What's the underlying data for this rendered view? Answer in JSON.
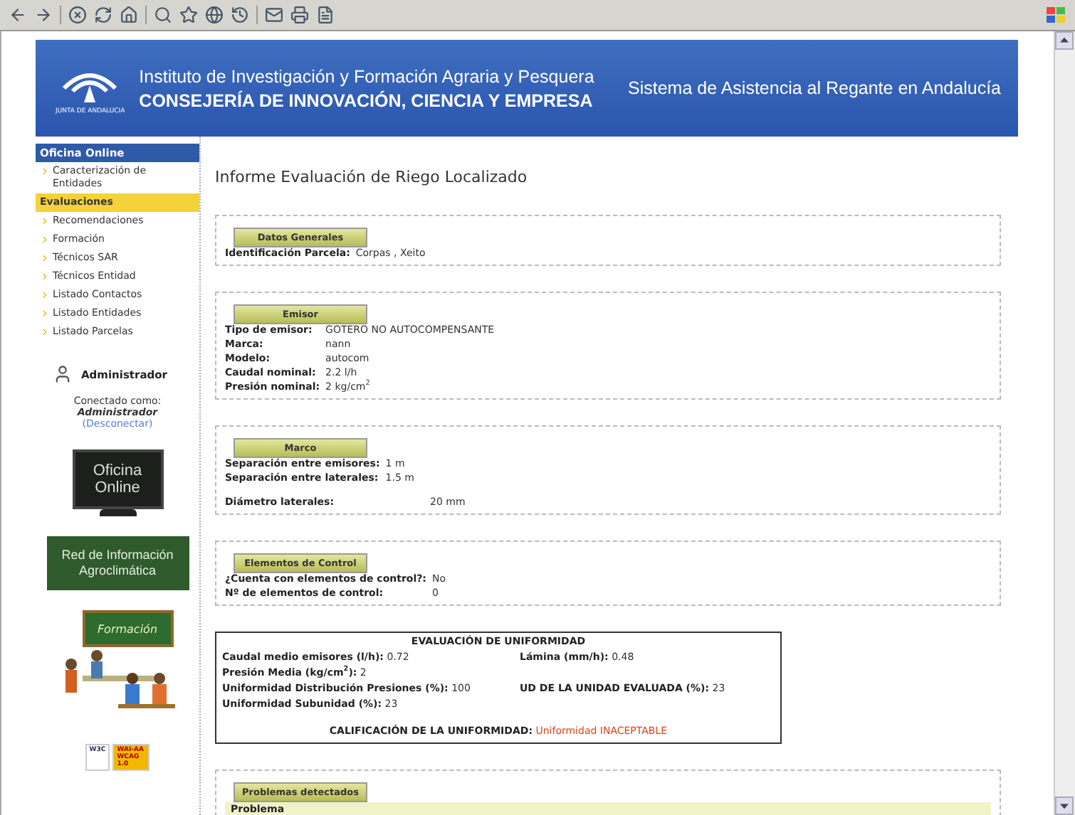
{
  "header": {
    "logo_caption": "JUNTA DE ANDALUCIA",
    "institute": "Instituto de Investigación y Formación Agraria y Pesquera",
    "ministry": "CONSEJERÍA DE INNOVACIÓN, CIENCIA Y EMPRESA",
    "system_title": "Sistema de Asistencia al Regante en Andalucía"
  },
  "sidebar": {
    "heading": "Oficina Online",
    "items": [
      {
        "label": "Caracterización de Entidades",
        "selected": false
      },
      {
        "label": "Evaluaciones",
        "selected": true
      },
      {
        "label": "Recomendaciones",
        "selected": false
      },
      {
        "label": "Formación",
        "selected": false
      },
      {
        "label": "Técnicos SAR",
        "selected": false
      },
      {
        "label": "Técnicos Entidad",
        "selected": false
      },
      {
        "label": "Listado Contactos",
        "selected": false
      },
      {
        "label": "Listado Entidades",
        "selected": false
      },
      {
        "label": "Listado Parcelas",
        "selected": false
      }
    ],
    "user": {
      "role": "Administrador",
      "connected_as": "Conectado como:",
      "name": "Administrador",
      "logout": "(Desconectar)"
    },
    "banners": [
      {
        "kind": "monitor",
        "text": "Oficina Online"
      },
      {
        "kind": "board",
        "text": "Red de Información Agroclimática"
      },
      {
        "kind": "classroom",
        "text": "Formación"
      }
    ],
    "badges": [
      {
        "text": "W3C"
      },
      {
        "text": "WAI-AA WCAG 1.0"
      }
    ]
  },
  "main": {
    "title": "Informe Evaluación de Riego Localizado",
    "sections": [
      {
        "legend": "Datos Generales",
        "fields": [
          {
            "label": "Identificación Parcela:",
            "value": "Corpas , Xeito"
          }
        ]
      },
      {
        "legend": "Emisor",
        "fields": [
          {
            "label": "Tipo de emisor:",
            "value": "GOTERO NO AUTOCOMPENSANTE"
          },
          {
            "label": "Marca:",
            "value": "nann"
          },
          {
            "label": "Modelo:",
            "value": "autocom"
          },
          {
            "label": "Caudal nominal:",
            "value": "2.2 l/h"
          },
          {
            "label": "Presión nominal:",
            "value": "2 kg/cm$^{2}$"
          }
        ]
      },
      {
        "legend": "Marco",
        "fields": [
          {
            "label": "Separación entre emisores:",
            "value": "1 m"
          },
          {
            "label": "Separación entre laterales:",
            "value": "1.5 m"
          }
        ],
        "more_fields": [
          {
            "label": "Diámetro laterales:",
            "value": "20 mm"
          }
        ]
      },
      {
        "legend": "Elementos de Control",
        "fields": [
          {
            "label": "¿Cuenta con elementos de control?:",
            "value": "No"
          },
          {
            "label": "Nº de elementos de control:",
            "value": "0"
          }
        ]
      }
    ],
    "evaluation": {
      "title": "EVALUACIÓN DE UNIFORMIDAD",
      "rows": [
        [
          {
            "label": "Caudal medio emisores (l/h):",
            "value": "0.72"
          },
          {
            "label": "Lámina (mm/h):",
            "value": "0.48"
          }
        ],
        [
          {
            "label": "Presión Media (kg/cm$^{2}$):",
            "value": "2"
          }
        ],
        [
          {
            "label": "Uniformidad Distribución Presiones (%):",
            "value": "100"
          },
          {
            "label": "UD DE LA UNIDAD EVALUADA (%):",
            "value": "23"
          }
        ],
        [
          {
            "label": "Uniformidad Subunidad (%):",
            "value": "23"
          }
        ]
      ],
      "rating": {
        "label": "CALIFICACIÓN DE LA UNIFORMIDAD:",
        "value": "Uniformidad INACEPTABLE"
      }
    },
    "problems": {
      "legend": "Problemas detectados",
      "column_header": "Problema"
    }
  }
}
